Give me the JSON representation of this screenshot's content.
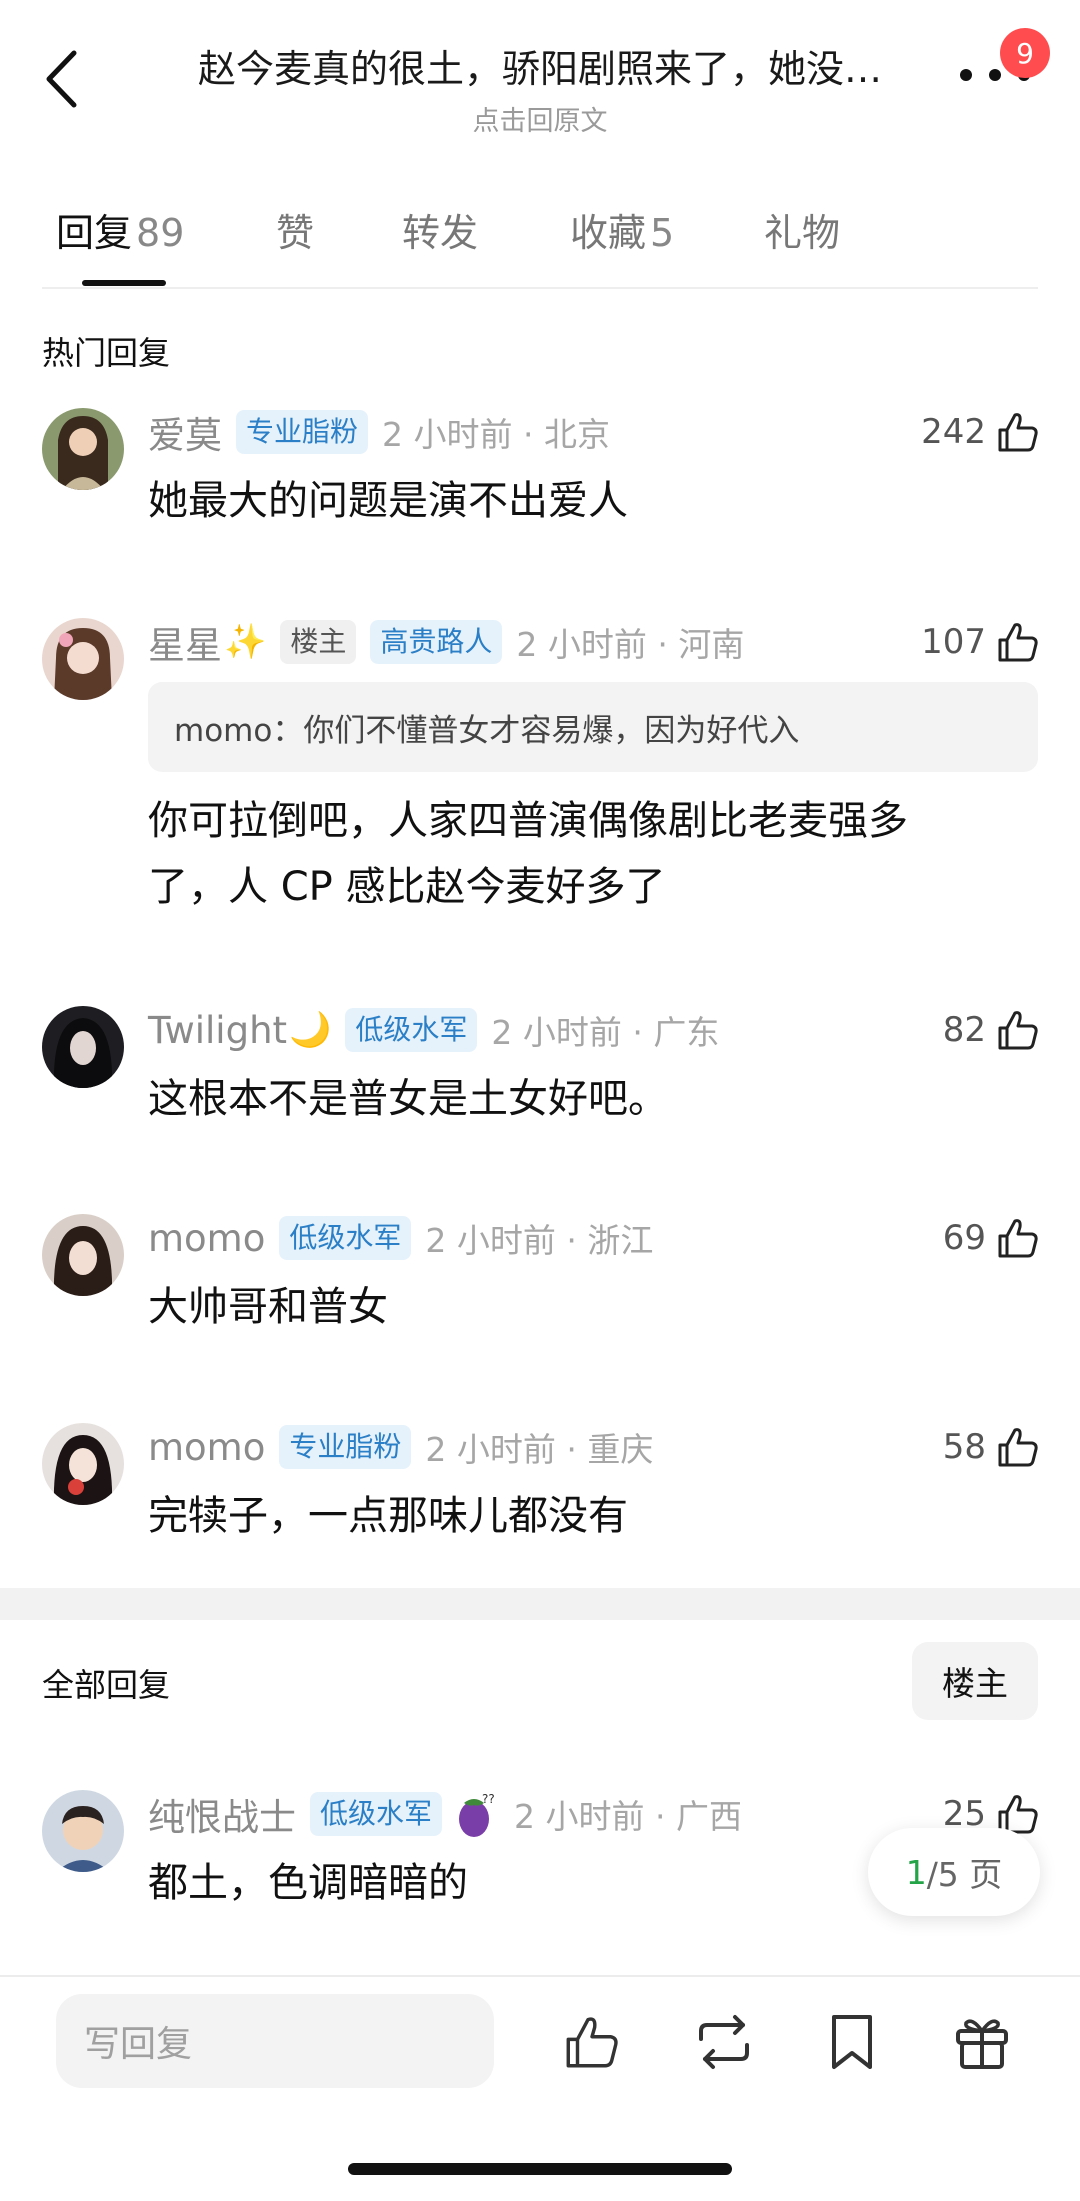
{
  "header": {
    "title": "赵今麦真的很土，骄阳剧照来了，她没…",
    "subtitle": "点击回原文",
    "badge_count": "9"
  },
  "tabs": [
    {
      "label": "回复",
      "count": "89"
    },
    {
      "label": "赞",
      "count": ""
    },
    {
      "label": "转发",
      "count": ""
    },
    {
      "label": "收藏",
      "count": "5"
    },
    {
      "label": "礼物",
      "count": ""
    }
  ],
  "hot": {
    "title": "热门回复",
    "comments": [
      {
        "name": "爱莫",
        "tags": [
          "专业脂粉"
        ],
        "time": "2 小时前 · 北京",
        "likes": "242",
        "text": "她最大的问题是演不出爱人"
      },
      {
        "name": "星星",
        "deco": "✨",
        "tags": [
          "楼主",
          "高贵路人"
        ],
        "time": "2 小时前 · 河南",
        "likes": "107",
        "quote": "momo：你们不懂普女才容易爆，因为好代入",
        "text_line1": "你可拉倒吧，人家四普演偶像剧比老麦强多",
        "text_line2": "了，人 CP 感比赵今麦好多了"
      },
      {
        "name": "Twilight",
        "deco": "🌙",
        "tags": [
          "低级水军"
        ],
        "time": "2 小时前 · 广东",
        "likes": "82",
        "text": "这根本不是普女是土女好吧。"
      },
      {
        "name": "momo",
        "tags": [
          "低级水军"
        ],
        "time": "2 小时前 · 浙江",
        "likes": "69",
        "text": "大帅哥和普女"
      },
      {
        "name": "momo",
        "tags": [
          "专业脂粉"
        ],
        "time": "2 小时前 · 重庆",
        "likes": "58",
        "text": "完犊子，一点那味儿都没有"
      }
    ]
  },
  "all": {
    "title": "全部回复",
    "owner_button": "楼主",
    "comments": [
      {
        "name": "纯恨战士",
        "tags": [
          "低级水军"
        ],
        "time": "2 小时前 · 广西",
        "likes": "25",
        "text": "都土，色调暗暗的"
      }
    ]
  },
  "pager": {
    "current": "1",
    "total": "/5 页"
  },
  "bottom_bar": {
    "reply_placeholder": "写回复"
  },
  "colors": {
    "tag_blue_bg": "#e6f2fb",
    "tag_blue_text": "#2b7fc6",
    "badge": "#ff4d4f",
    "pager_current": "#22a447"
  }
}
